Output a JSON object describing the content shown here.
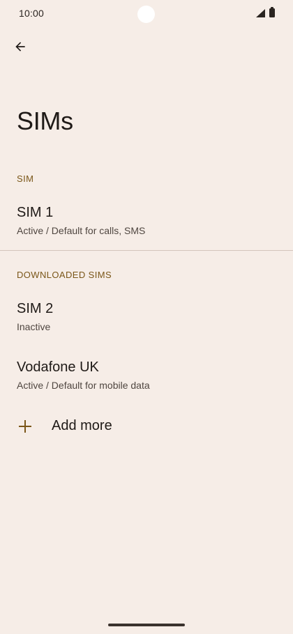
{
  "status_bar": {
    "time": "10:00",
    "icons": [
      "signal-icon",
      "battery-icon"
    ]
  },
  "toolbar": {
    "back_icon": "arrow-back-icon"
  },
  "page": {
    "title": "SIMs"
  },
  "sections": {
    "sim": {
      "header": "SIM",
      "items": [
        {
          "title": "SIM 1",
          "subtitle": "Active / Default for calls, SMS"
        }
      ]
    },
    "downloaded": {
      "header": "DOWNLOADED SIMS",
      "items": [
        {
          "title": "SIM 2",
          "subtitle": "Inactive"
        },
        {
          "title": "Vodafone UK",
          "subtitle": "Active / Default for mobile data"
        }
      ]
    }
  },
  "add_more": {
    "label": "Add more",
    "icon": "plus-icon"
  },
  "colors": {
    "background": "#f6ede7",
    "accent": "#7a5618",
    "text_primary": "#1f1a17",
    "text_secondary": "#4f4640"
  }
}
